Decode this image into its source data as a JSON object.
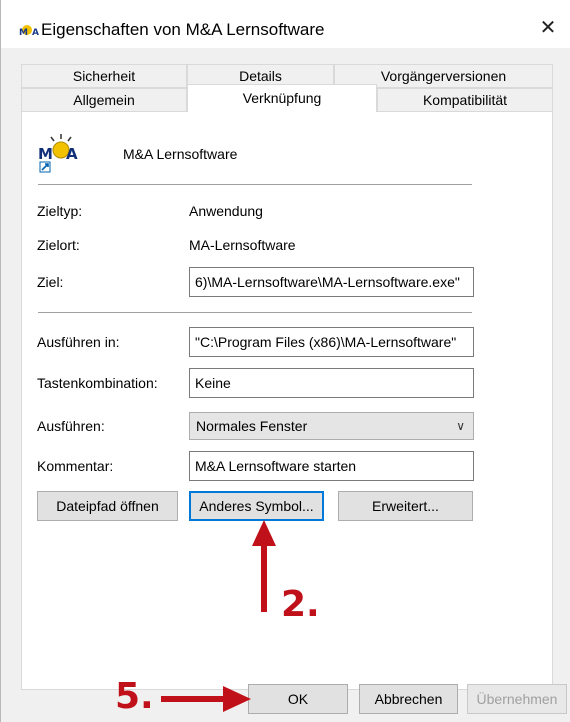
{
  "window": {
    "title": "Eigenschaften von M&A Lernsoftware",
    "close_label": "✕"
  },
  "tabs": {
    "row1": [
      "Sicherheit",
      "Details",
      "Vorgängerversionen"
    ],
    "row2": [
      "Allgemein",
      "Verknüpfung",
      "Kompatibilität"
    ],
    "active": "Verknüpfung"
  },
  "shortcut": {
    "name": "M&A Lernsoftware",
    "icon": "ma-lernsoftware-icon",
    "fields": {
      "zieltyp_label": "Zieltyp:",
      "zieltyp_value": "Anwendung",
      "zielort_label": "Zielort:",
      "zielort_value": "MA-Lernsoftware",
      "ziel_label": "Ziel:",
      "ziel_value": "6)\\MA-Lernsoftware\\MA-Lernsoftware.exe\"",
      "ausfuehren_in_label": "Ausführen in:",
      "ausfuehren_in_value": "\"C:\\Program Files (x86)\\MA-Lernsoftware\"",
      "tasten_label": "Tastenkombination:",
      "tasten_value": "Keine",
      "ausfuehren_label": "Ausführen:",
      "ausfuehren_value": "Normales Fenster",
      "kommentar_label": "Kommentar:",
      "kommentar_value": "M&A Lernsoftware starten"
    },
    "buttons": {
      "dateipfad": "Dateipfad öffnen",
      "anderes_symbol": "Anderes Symbol...",
      "erweitert": "Erweitert..."
    }
  },
  "footer": {
    "ok": "OK",
    "abbrechen": "Abbrechen",
    "uebernehmen": "Übernehmen"
  },
  "annotations": {
    "step2": "2.",
    "step5": "5.",
    "color": "#c0101a"
  }
}
